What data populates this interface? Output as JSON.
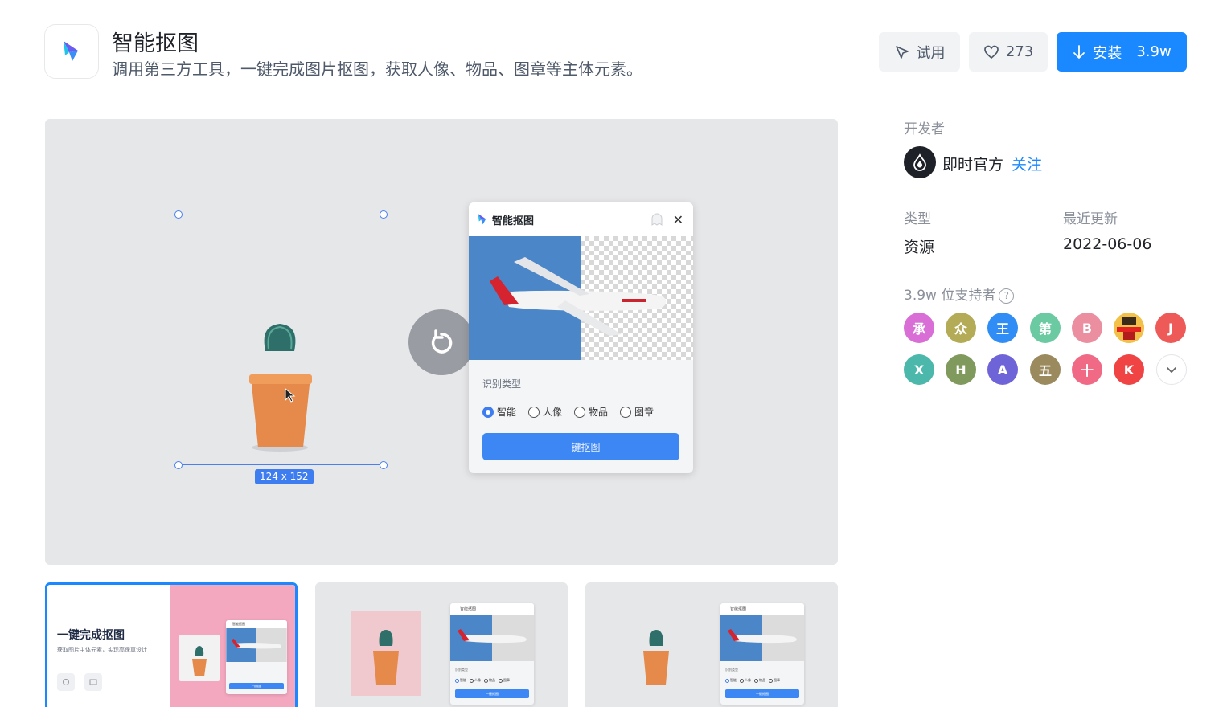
{
  "app": {
    "title": "智能抠图",
    "description": "调用第三方工具，一键完成图片抠图，获取人像、物品、图章等主体元素。"
  },
  "actions": {
    "try_label": "试用",
    "like_count": "273",
    "install_label": "安装",
    "install_count": "3.9w"
  },
  "preview": {
    "size_tag": "124 x 152",
    "dialog": {
      "title": "智能抠图",
      "section_label": "识别类型",
      "options": [
        "智能",
        "人像",
        "物品",
        "图章"
      ],
      "selected_option": "智能",
      "submit_label": "一键抠图"
    }
  },
  "thumbnails": {
    "first": {
      "title": "一键完成抠图",
      "subtitle": "获取图片主体元素，实现高保真设计"
    },
    "mini_dialog": {
      "title": "智能抠图",
      "section_label": "识别类型",
      "options": [
        "智能",
        "人像",
        "物品",
        "图章"
      ],
      "submit_label": "一键抠图"
    }
  },
  "sidebar": {
    "developer_label": "开发者",
    "developer_name": "即时官方",
    "follow_label": "关注",
    "type_label": "类型",
    "type_value": "资源",
    "updated_label": "最近更新",
    "updated_value": "2022-06-06",
    "supporters_label": "3.9w 位支持者",
    "supporters": [
      {
        "initial": "承",
        "color": "#d86ed6"
      },
      {
        "initial": "众",
        "color": "#b3ab55"
      },
      {
        "initial": "王",
        "color": "#2f8df5"
      },
      {
        "initial": "第",
        "color": "#6bcaa2"
      },
      {
        "initial": "B",
        "color": "#ea8ea0"
      },
      {
        "initial": "",
        "color": "#f2c14a"
      },
      {
        "initial": "J",
        "color": "#ee5a57"
      },
      {
        "initial": "X",
        "color": "#4bb8ab"
      },
      {
        "initial": "H",
        "color": "#7f9a5c"
      },
      {
        "initial": "A",
        "color": "#6f63d8"
      },
      {
        "initial": "五",
        "color": "#9a8a5e"
      },
      {
        "initial": "十",
        "color": "#f06a86"
      },
      {
        "initial": "K",
        "color": "#f04444"
      }
    ]
  },
  "colors": {
    "primary": "#1a89ff",
    "preview_bg": "#e6e7e9"
  }
}
